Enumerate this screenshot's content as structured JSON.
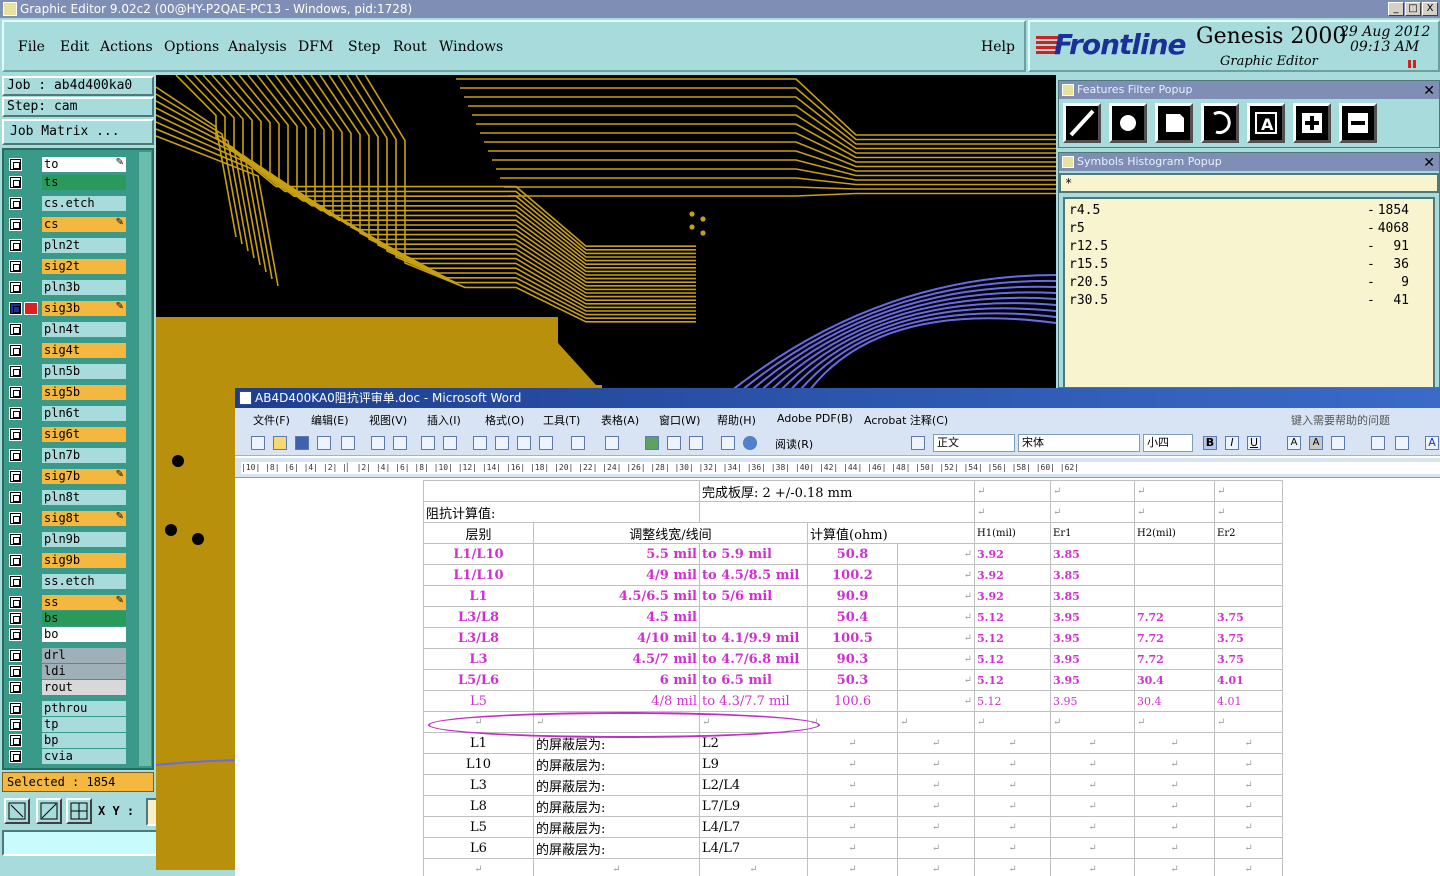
{
  "app_title": "Graphic Editor 9.02c2 (00@HY-P2QAE-PC13 - Windows, pid:1728)",
  "window_buttons": [
    "_",
    "□",
    "X"
  ],
  "menu": [
    "File",
    "Edit",
    "Actions",
    "Options",
    "Analysis",
    "DFM",
    "Step",
    "Rout",
    "Windows"
  ],
  "help_label": "Help",
  "logo": {
    "brand": "Frontline",
    "product": "Genesis 2000",
    "subtitle": "Graphic Editor",
    "date": "29 Aug 2012",
    "time": "09:13 AM"
  },
  "job": {
    "label": "Job : ab4d400ka0",
    "step": "Step: cam",
    "matrix_button": "Job Matrix ..."
  },
  "layers": [
    {
      "name": "to",
      "color": "#ffffff",
      "edit": true
    },
    {
      "name": "ts",
      "color": "#2a9a5a",
      "edit": false
    },
    {
      "name": "cs.etch",
      "color": "#a8dcdc",
      "edit": false
    },
    {
      "name": "cs",
      "color": "#f4b840",
      "edit": true
    },
    {
      "name": "pln2t",
      "color": "#a8dcdc",
      "edit": false
    },
    {
      "name": "sig2t",
      "color": "#f4b840",
      "edit": false
    },
    {
      "name": "pln3b",
      "color": "#a8dcdc",
      "edit": false
    },
    {
      "name": "sig3b",
      "color": "#f4b840",
      "edit": true,
      "work": true
    },
    {
      "name": "pln4t",
      "color": "#a8dcdc",
      "edit": false
    },
    {
      "name": "sig4t",
      "color": "#f4b840",
      "edit": false
    },
    {
      "name": "pln5b",
      "color": "#a8dcdc",
      "edit": false
    },
    {
      "name": "sig5b",
      "color": "#f4b840",
      "edit": false
    },
    {
      "name": "pln6t",
      "color": "#a8dcdc",
      "edit": false
    },
    {
      "name": "sig6t",
      "color": "#f4b840",
      "edit": false
    },
    {
      "name": "pln7b",
      "color": "#a8dcdc",
      "edit": false
    },
    {
      "name": "sig7b",
      "color": "#f4b840",
      "edit": true
    },
    {
      "name": "pln8t",
      "color": "#a8dcdc",
      "edit": false
    },
    {
      "name": "sig8t",
      "color": "#f4b840",
      "edit": true
    },
    {
      "name": "pln9b",
      "color": "#a8dcdc",
      "edit": false
    },
    {
      "name": "sig9b",
      "color": "#f4b840",
      "edit": false
    },
    {
      "name": "ss.etch",
      "color": "#a8dcdc",
      "edit": false
    },
    {
      "name": "ss",
      "color": "#f4b840",
      "edit": true
    },
    {
      "name": "bs",
      "color": "#2a9a5a",
      "edit": false
    },
    {
      "name": "bo",
      "color": "#ffffff",
      "edit": false
    },
    {
      "name": "drl",
      "color": "#a0b0b8",
      "edit": false
    },
    {
      "name": "ldi",
      "color": "#a0b0b8",
      "edit": false
    },
    {
      "name": "rout",
      "color": "#d8d8d8",
      "edit": false
    },
    {
      "name": "pthrou",
      "color": "#a8dcdc",
      "edit": false
    },
    {
      "name": "tp",
      "color": "#a8dcdc",
      "edit": false
    },
    {
      "name": "bp",
      "color": "#a8dcdc",
      "edit": false
    },
    {
      "name": "cvia",
      "color": "#a8dcdc",
      "edit": false
    }
  ],
  "selected_label": "Selected : 1854",
  "xy_label": "X Y :",
  "features_popup": {
    "title": "Features Filter Popup"
  },
  "histogram_popup": {
    "title": "Symbols Histogram Popup",
    "filter": "*",
    "rows": [
      {
        "symbol": "r4.5",
        "count": "1854"
      },
      {
        "symbol": "r5",
        "count": "4068"
      },
      {
        "symbol": "r12.5",
        "count": "91"
      },
      {
        "symbol": "r15.5",
        "count": "36"
      },
      {
        "symbol": "r20.5",
        "count": "9"
      },
      {
        "symbol": "r30.5",
        "count": "41"
      }
    ]
  },
  "word": {
    "title": "AB4D400KA0阻抗评审单.doc - Microsoft Word",
    "menu": [
      "文件(F)",
      "编辑(E)",
      "视图(V)",
      "插入(I)",
      "格式(O)",
      "工具(T)",
      "表格(A)",
      "窗口(W)",
      "帮助(H)",
      "Adobe PDF(B)",
      "Acrobat 注释(C)"
    ],
    "help_box": "键入需要帮助的问题",
    "style": "正文",
    "font": "宋体",
    "size": "小四",
    "read_button": "阅读(R)",
    "doc": {
      "thickness_label": "完成板厚:",
      "thickness_value": "2 +/-0.18 mm",
      "calc_label": "阻抗计算值:",
      "headers": [
        "层别",
        "调整线宽/线间",
        "计算值(ohm)",
        "H1(mil)",
        "Er1",
        "H2(mil)",
        "Er2"
      ],
      "rows": [
        {
          "layer": "L1/L10",
          "orig": "5.5 mil",
          "adj": "to 5.9 mil",
          "calc": "50.8",
          "h1": "3.92",
          "er1": "3.85",
          "h2": "",
          "er2": ""
        },
        {
          "layer": "L1/L10",
          "orig": "4/9 mil",
          "adj": "to 4.5/8.5 mil",
          "calc": "100.2",
          "h1": "3.92",
          "er1": "3.85",
          "h2": "",
          "er2": ""
        },
        {
          "layer": "L1",
          "orig": "4.5/6.5 mil",
          "adj": "to 5/6 mil",
          "calc": "90.9",
          "h1": "3.92",
          "er1": "3.85",
          "h2": "",
          "er2": ""
        },
        {
          "layer": "L3/L8",
          "orig": "4.5 mil",
          "adj": "",
          "calc": "50.4",
          "h1": "5.12",
          "er1": "3.95",
          "h2": "7.72",
          "er2": "3.75"
        },
        {
          "layer": "L3/L8",
          "orig": "4/10 mil",
          "adj": "to 4.1/9.9 mil",
          "calc": "100.5",
          "h1": "5.12",
          "er1": "3.95",
          "h2": "7.72",
          "er2": "3.75"
        },
        {
          "layer": "L3",
          "orig": "4.5/7 mil",
          "adj": "to 4.7/6.8 mil",
          "calc": "90.3",
          "h1": "5.12",
          "er1": "3.95",
          "h2": "7.72",
          "er2": "3.75"
        },
        {
          "layer": "L5/L6",
          "orig": "6 mil",
          "adj": "to 6.5 mil",
          "calc": "50.3",
          "h1": "5.12",
          "er1": "3.95",
          "h2": "30.4",
          "er2": "4.01"
        },
        {
          "layer": "L5",
          "orig": "4/8 mil",
          "adj": "to 4.3/7.7 mil",
          "calc": "100.6",
          "h1": "5.12",
          "er1": "3.95",
          "h2": "30.4",
          "er2": "4.01"
        }
      ],
      "shield_label": "的屏蔽层为:",
      "shields": [
        {
          "layer": "L1",
          "ref": "L2"
        },
        {
          "layer": "L10",
          "ref": "L9"
        },
        {
          "layer": "L3",
          "ref": "L2/L4"
        },
        {
          "layer": "L8",
          "ref": "L7/L9"
        },
        {
          "layer": "L5",
          "ref": "L4/L7"
        },
        {
          "layer": "L6",
          "ref": "L4/L7"
        }
      ]
    }
  },
  "colors": {
    "trace": "#c8a010",
    "copper": "#b8900c",
    "arc": "#6a6ae8",
    "teal": "#a8dcdc",
    "magenta": "#d030d0"
  }
}
